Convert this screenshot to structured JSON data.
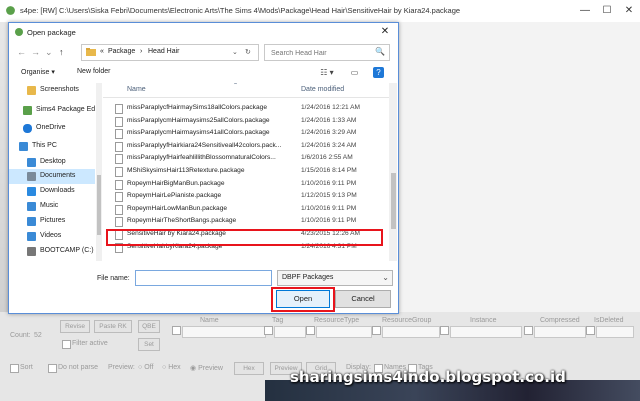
{
  "window": {
    "title": "s4pe: [RW] C:\\Users\\Siska Febri\\Documents\\Electronic Arts\\The Sims 4\\Mods\\Package\\Head Hair\\SensitiveHair by Kiara24.package",
    "minimize": "—",
    "maximize": "☐",
    "close": "✕"
  },
  "dialog": {
    "title": "Open package",
    "close": "✕",
    "nav": {
      "back": "←",
      "forward": "→",
      "up": "↑",
      "down": "⌄",
      "refresh": "↻"
    },
    "address": {
      "prefix": "«",
      "segments": [
        "Package",
        "›",
        "Head Hair"
      ],
      "chevron": "⌄"
    },
    "search": {
      "placeholder": "Search Head Hair",
      "icon": "🔍"
    },
    "commands": {
      "organise": "Organise ▾",
      "new_folder": "New folder",
      "view": "☷ ▾",
      "pane": "▭",
      "help": "?"
    },
    "navpane": [
      {
        "label": "Screenshots",
        "icon": "folder-icon",
        "color": "#e8b84b"
      },
      {
        "label": "Sims4 Package Ed",
        "icon": "app-icon",
        "color": "#5aa04a"
      },
      {
        "label": "OneDrive",
        "icon": "cloud-icon",
        "color": "#1e78d7"
      },
      {
        "label": "This PC",
        "icon": "computer-icon",
        "color": "#3a8ad6"
      },
      {
        "label": "Desktop",
        "icon": "desktop-icon",
        "color": "#3a8ad6"
      },
      {
        "label": "Documents",
        "icon": "documents-icon",
        "color": "#7a8a9a",
        "selected": true
      },
      {
        "label": "Downloads",
        "icon": "download-icon",
        "color": "#2a8ae0"
      },
      {
        "label": "Music",
        "icon": "music-icon",
        "color": "#3a8ad6"
      },
      {
        "label": "Pictures",
        "icon": "pictures-icon",
        "color": "#3a8ad6"
      },
      {
        "label": "Videos",
        "icon": "videos-icon",
        "color": "#3a8ad6"
      },
      {
        "label": "BOOTCAMP (C:)",
        "icon": "drive-icon",
        "color": "#777777"
      }
    ],
    "columns": {
      "name": "Name",
      "date": "Date modified",
      "sort": "⌃"
    },
    "files": [
      {
        "name": "missParaplycfHairmaySims18allColors.package",
        "date": "1/24/2016 12:21 AM"
      },
      {
        "name": "missParaplycmHairmaysims25allColors.package",
        "date": "1/24/2016 1:33 AM"
      },
      {
        "name": "missParaplycmHairmaysims41allColors.package",
        "date": "1/24/2016 3:29 AM"
      },
      {
        "name": "missParaplyyfHairkiara24Sensitiveall42colors.pack...",
        "date": "1/24/2016 3:24 AM"
      },
      {
        "name": "missParaplyyfHairfeahlillithBlossomnaturalColors...",
        "date": "1/6/2016 2:55 AM"
      },
      {
        "name": "MShiSkysimsHair113Retexture.package",
        "date": "1/15/2016 8:14 PM"
      },
      {
        "name": "RopeymHairBigManBun.package",
        "date": "1/10/2016 9:11 PM"
      },
      {
        "name": "RopeymHairLePianiste.package",
        "date": "1/12/2015 9:13 PM"
      },
      {
        "name": "RopeymHairLowManBun.package",
        "date": "1/10/2016 9:11 PM"
      },
      {
        "name": "RopeymHairTheShortBangs.package",
        "date": "1/10/2016 9:11 PM"
      },
      {
        "name": "SensitiveHair by Kiara24.package",
        "date": "4/23/2015 12:26 AM",
        "highlighted": true
      },
      {
        "name": "SensitiveHairbyKiara24.package",
        "date": "1/24/2016 4:31 PM"
      }
    ],
    "filename": {
      "label": "File name:",
      "value": ""
    },
    "filter": {
      "value": "DBPF Packages",
      "arrow": "⌄"
    },
    "open_label": "Open",
    "cancel_label": "Cancel"
  },
  "lower_panel": {
    "count_label": "Count:",
    "count_value": "52",
    "buttons": {
      "revise": "Revise",
      "paste_rk": "Paste RK",
      "qbe": "QBE",
      "set": "Set"
    },
    "filter_active": "Filter active",
    "columns": [
      "Name",
      "Tag",
      "ResourceType",
      "ResourceGroup",
      "Instance",
      "Compressed",
      "IsDeleted"
    ],
    "sort_label": "Sort",
    "do_not_parse": "Do not parse",
    "preview_label": "Preview:",
    "preview_options": [
      "Off",
      "Hex",
      "Preview"
    ],
    "hex_btn": "Hex",
    "preview_btn": "Preview",
    "grid_btn": "Grid",
    "display_label": "Display:",
    "names_label": "Names",
    "tags_label": "Tags"
  },
  "watermark": "sharingsims4indo.blogspot.co.id",
  "colors": {
    "accent": "#0078d7",
    "highlight": "#e8141c",
    "selection": "#cce8ff"
  }
}
